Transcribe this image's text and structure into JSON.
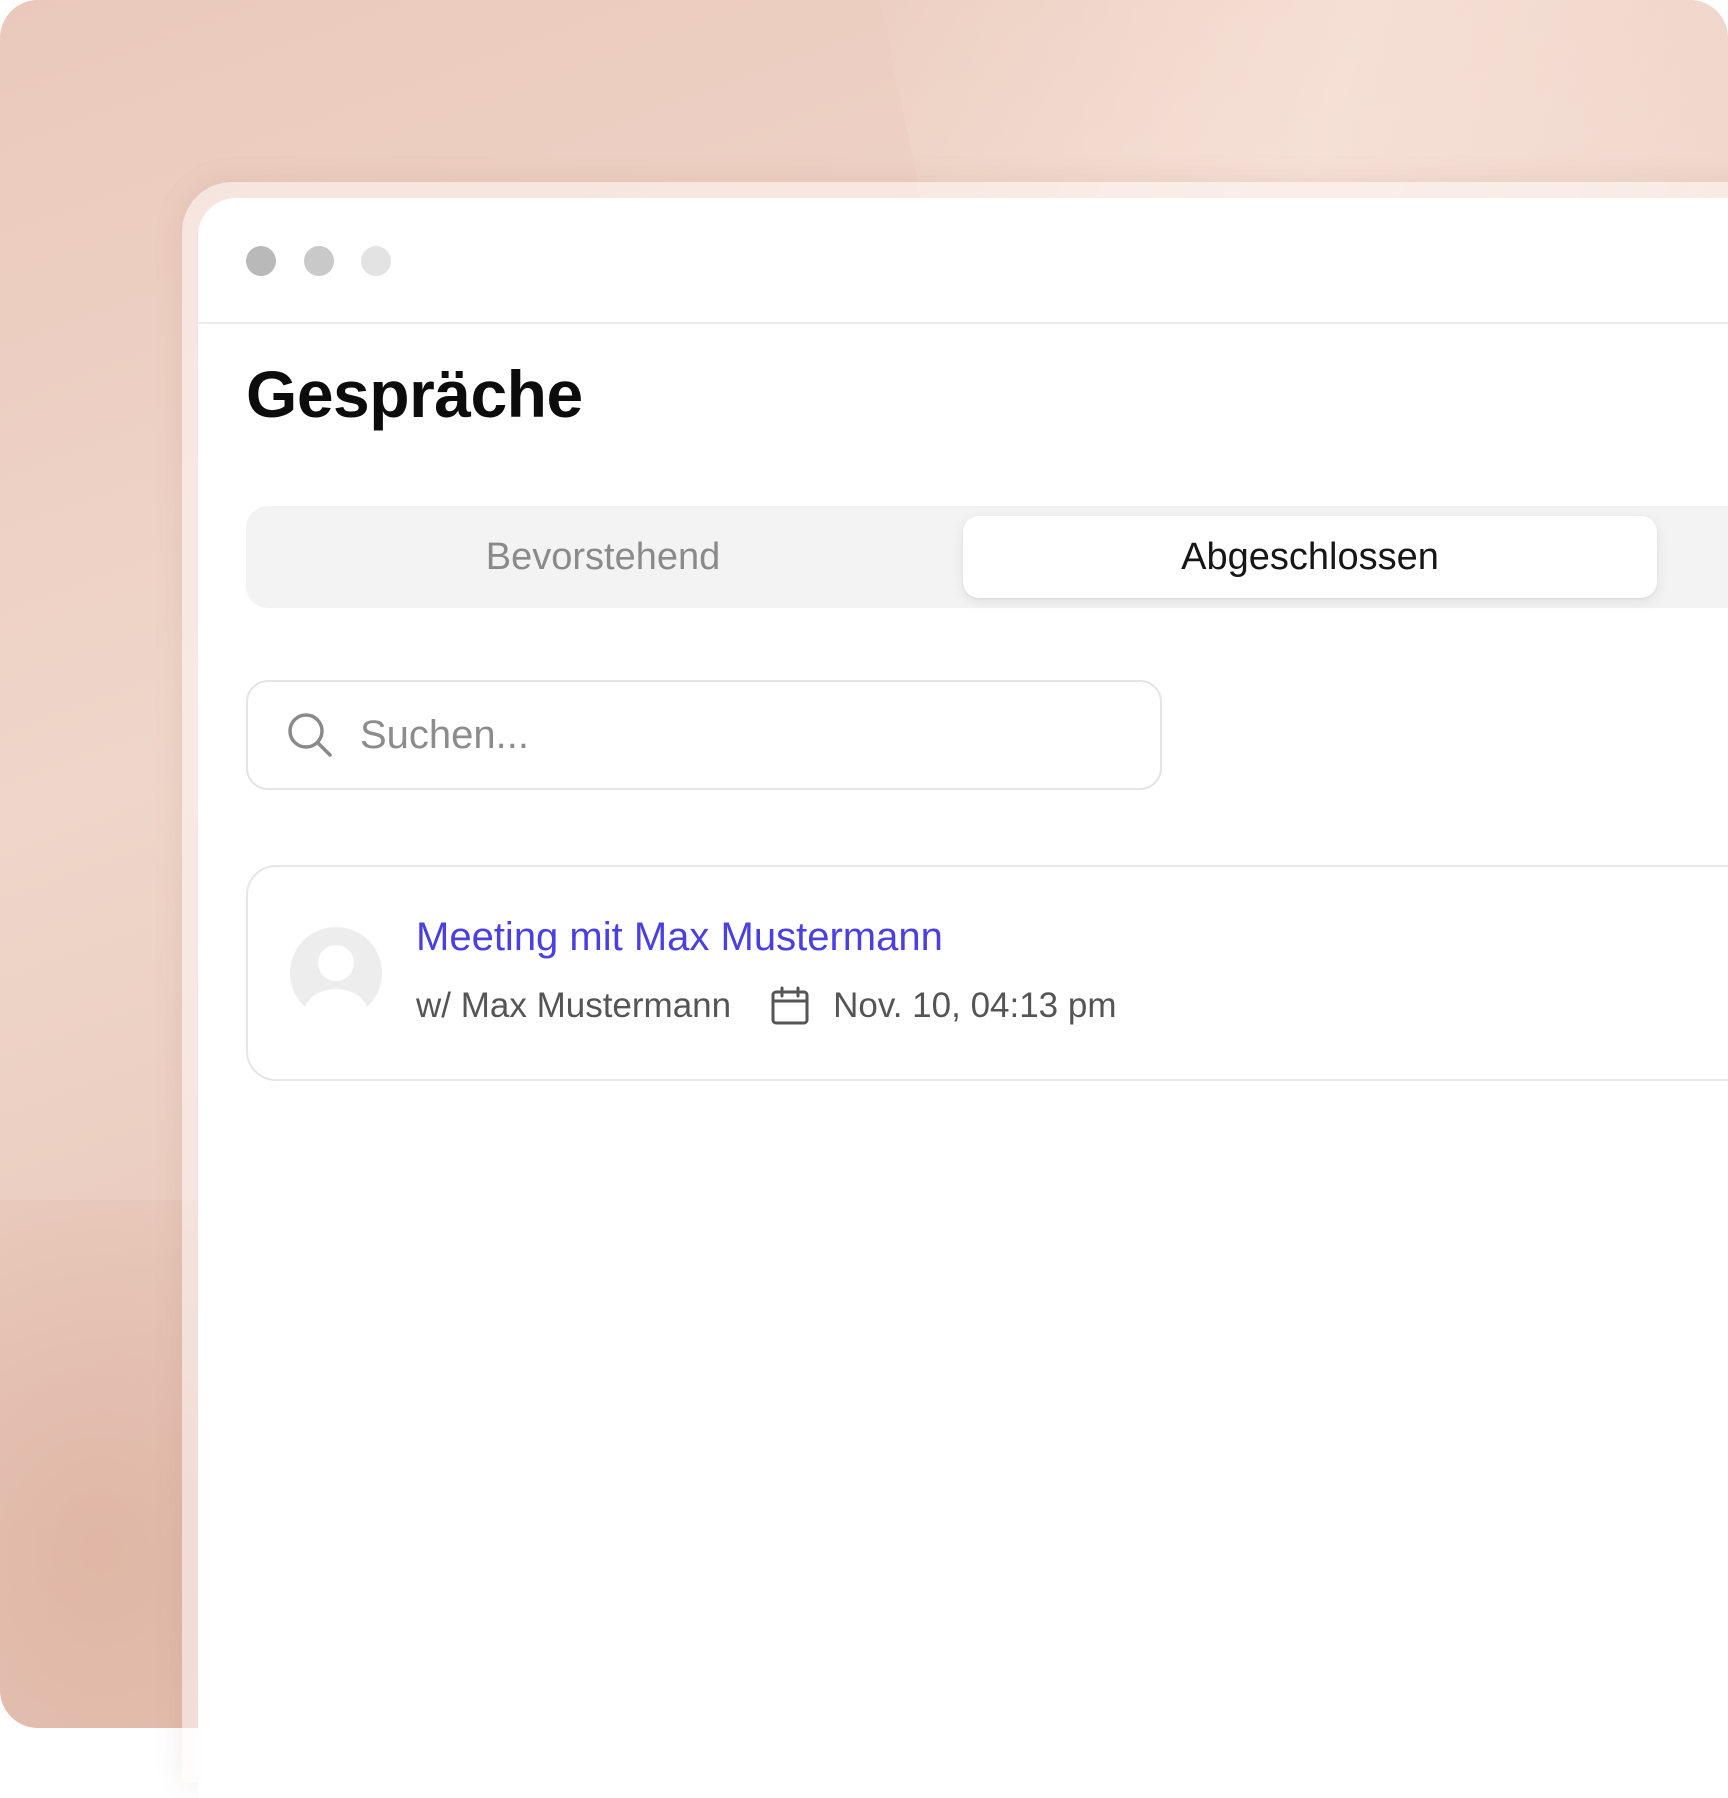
{
  "page": {
    "title": "Gespräche"
  },
  "tabs": [
    {
      "label": "Bevorstehend",
      "selected": false
    },
    {
      "label": "Abgeschlossen",
      "selected": true
    }
  ],
  "search": {
    "placeholder": "Suchen...",
    "value": "",
    "icon": "search-icon"
  },
  "conversations": [
    {
      "title": "Meeting mit Max Mustermann",
      "participant": "w/ Max Mustermann",
      "date": "Nov. 10, 04:13 pm",
      "avatar_icon": "user-avatar-icon",
      "date_icon": "calendar-icon"
    }
  ],
  "colors": {
    "accent": "#4a3fe0",
    "window_bg": "#ffffff",
    "segment_bg": "#f3f3f3",
    "muted_text": "#8a8a8a"
  }
}
